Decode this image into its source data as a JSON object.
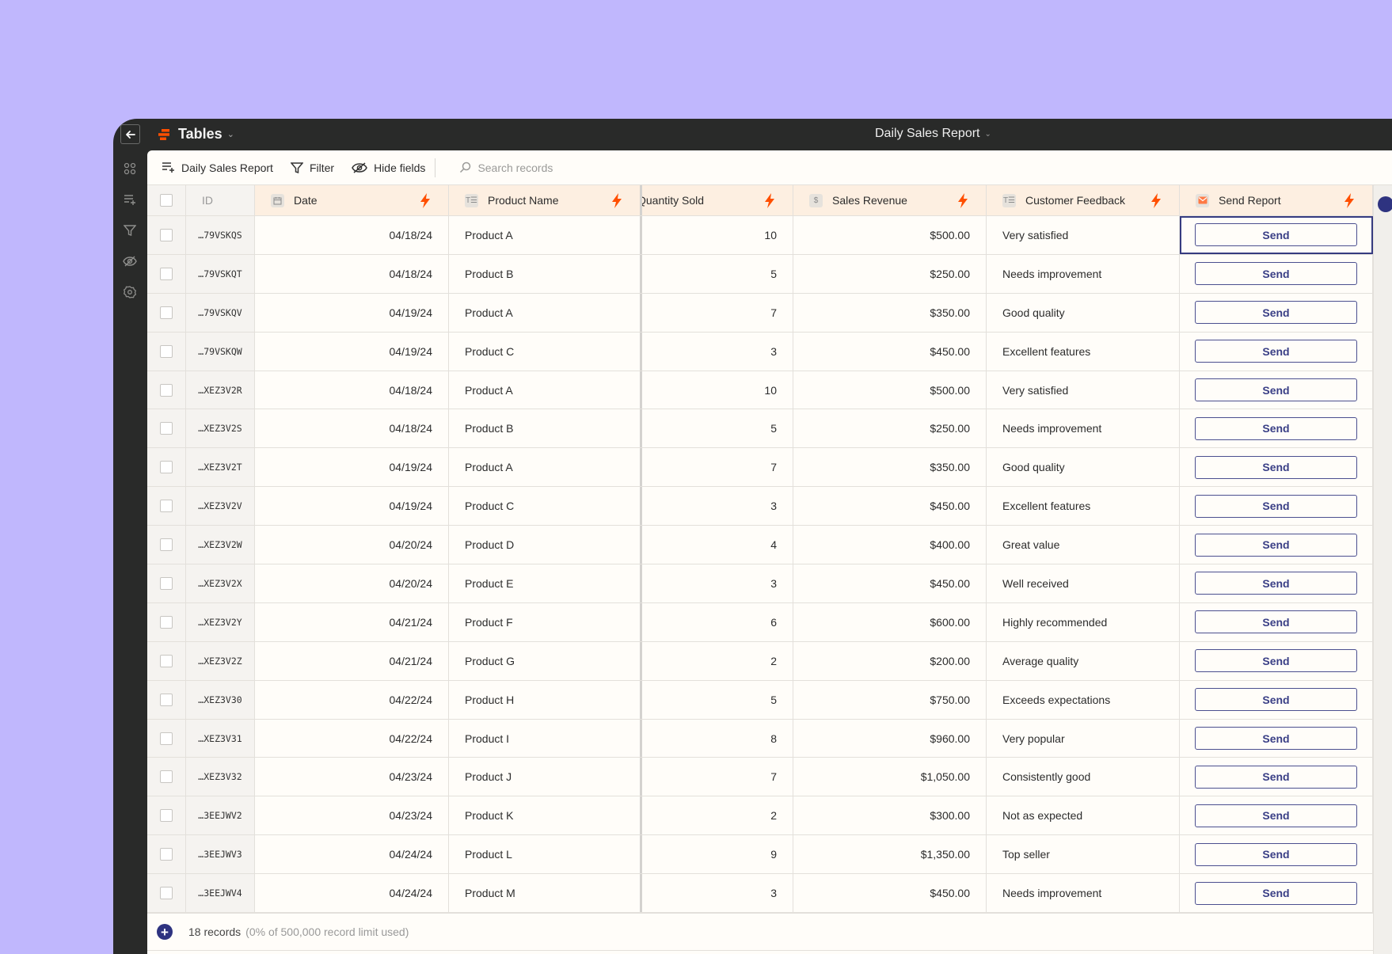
{
  "topbar": {
    "app_title": "Tables",
    "doc_title": "Daily Sales Report",
    "back_icon": "arrow-left-icon",
    "logo_icon": "tables-logo-icon"
  },
  "sidebar": {
    "items": [
      {
        "icon": "apps-icon"
      },
      {
        "icon": "add-list-icon"
      },
      {
        "icon": "filter-icon"
      },
      {
        "icon": "hide-icon"
      },
      {
        "icon": "settings-icon"
      }
    ]
  },
  "toolbar": {
    "view_label": "Daily Sales Report",
    "filter_label": "Filter",
    "hide_fields_label": "Hide fields",
    "search_placeholder": "Search records"
  },
  "table": {
    "columns": [
      {
        "label": "ID"
      },
      {
        "label": "Date",
        "icon": "calendar-icon",
        "trigger": true
      },
      {
        "label": "Product Name",
        "icon": "text-icon",
        "trigger": true
      },
      {
        "label": "Quantity Sold",
        "trigger": true
      },
      {
        "label": "Sales Revenue",
        "icon": "dollar-icon",
        "trigger": true
      },
      {
        "label": "Customer Feedback",
        "icon": "text-icon",
        "trigger": true
      },
      {
        "label": "Send Report",
        "icon": "email-icon",
        "trigger": true
      }
    ],
    "rows": [
      {
        "id": "…79VSKQS",
        "date": "04/18/24",
        "product": "Product A",
        "qty": "10",
        "revenue": "$500.00",
        "feedback": "Very satisfied",
        "action": "Send"
      },
      {
        "id": "…79VSKQT",
        "date": "04/18/24",
        "product": "Product B",
        "qty": "5",
        "revenue": "$250.00",
        "feedback": "Needs improvement",
        "action": "Send"
      },
      {
        "id": "…79VSKQV",
        "date": "04/19/24",
        "product": "Product A",
        "qty": "7",
        "revenue": "$350.00",
        "feedback": "Good quality",
        "action": "Send"
      },
      {
        "id": "…79VSKQW",
        "date": "04/19/24",
        "product": "Product C",
        "qty": "3",
        "revenue": "$450.00",
        "feedback": "Excellent features",
        "action": "Send"
      },
      {
        "id": "…XEZ3V2R",
        "date": "04/18/24",
        "product": "Product A",
        "qty": "10",
        "revenue": "$500.00",
        "feedback": "Very satisfied",
        "action": "Send"
      },
      {
        "id": "…XEZ3V2S",
        "date": "04/18/24",
        "product": "Product B",
        "qty": "5",
        "revenue": "$250.00",
        "feedback": "Needs improvement",
        "action": "Send"
      },
      {
        "id": "…XEZ3V2T",
        "date": "04/19/24",
        "product": "Product A",
        "qty": "7",
        "revenue": "$350.00",
        "feedback": "Good quality",
        "action": "Send"
      },
      {
        "id": "…XEZ3V2V",
        "date": "04/19/24",
        "product": "Product C",
        "qty": "3",
        "revenue": "$450.00",
        "feedback": "Excellent features",
        "action": "Send"
      },
      {
        "id": "…XEZ3V2W",
        "date": "04/20/24",
        "product": "Product D",
        "qty": "4",
        "revenue": "$400.00",
        "feedback": "Great value",
        "action": "Send"
      },
      {
        "id": "…XEZ3V2X",
        "date": "04/20/24",
        "product": "Product E",
        "qty": "3",
        "revenue": "$450.00",
        "feedback": "Well received",
        "action": "Send"
      },
      {
        "id": "…XEZ3V2Y",
        "date": "04/21/24",
        "product": "Product F",
        "qty": "6",
        "revenue": "$600.00",
        "feedback": "Highly recommended",
        "action": "Send"
      },
      {
        "id": "…XEZ3V2Z",
        "date": "04/21/24",
        "product": "Product G",
        "qty": "2",
        "revenue": "$200.00",
        "feedback": "Average quality",
        "action": "Send"
      },
      {
        "id": "…XEZ3V30",
        "date": "04/22/24",
        "product": "Product H",
        "qty": "5",
        "revenue": "$750.00",
        "feedback": "Exceeds expectations",
        "action": "Send"
      },
      {
        "id": "…XEZ3V31",
        "date": "04/22/24",
        "product": "Product I",
        "qty": "8",
        "revenue": "$960.00",
        "feedback": "Very popular",
        "action": "Send"
      },
      {
        "id": "…XEZ3V32",
        "date": "04/23/24",
        "product": "Product J",
        "qty": "7",
        "revenue": "$1,050.00",
        "feedback": "Consistently good",
        "action": "Send"
      },
      {
        "id": "…3EEJWV2",
        "date": "04/23/24",
        "product": "Product K",
        "qty": "2",
        "revenue": "$300.00",
        "feedback": "Not as expected",
        "action": "Send"
      },
      {
        "id": "…3EEJWV3",
        "date": "04/24/24",
        "product": "Product L",
        "qty": "9",
        "revenue": "$1,350.00",
        "feedback": "Top seller",
        "action": "Send"
      },
      {
        "id": "…3EEJWV4",
        "date": "04/24/24",
        "product": "Product M",
        "qty": "3",
        "revenue": "$450.00",
        "feedback": "Needs improvement",
        "action": "Send"
      }
    ]
  },
  "footer": {
    "record_count": "18 records",
    "record_limit": "(0% of 500,000 record limit used)"
  },
  "colors": {
    "background": "#c0b7fd",
    "chrome": "#292a29",
    "accent_orange": "#ff4f00",
    "header_row": "#fdefe1",
    "button_navy": "#3a3f86"
  }
}
